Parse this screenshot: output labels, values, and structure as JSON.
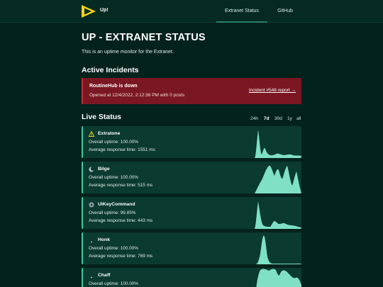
{
  "header": {
    "brand": "Up!",
    "nav": [
      {
        "label": "Extranet Status",
        "active": true
      },
      {
        "label": "GitHub",
        "active": false
      }
    ],
    "logo_icon": "play-triangle-icon"
  },
  "page": {
    "title": "UP - EXTRANET STATUS",
    "intro": "This is an uptime monitor for the Extranet."
  },
  "incidents": {
    "title": "Active Incidents",
    "items": [
      {
        "title": "RoutineHub is down",
        "opened": "Opened at 12/4/2022, 2:12:36 PM with 0 posts",
        "link": "Incident #548 report →"
      }
    ]
  },
  "live": {
    "title": "Live Status",
    "ranges": [
      "24h",
      "7d",
      "30d",
      "1y",
      "all"
    ],
    "active_range": "7d",
    "services": [
      {
        "name": "Extratone",
        "icon": "warning-triangle-icon",
        "uptime": "Overall uptime:  100.00%",
        "response": "Average response time:  1551 ms"
      },
      {
        "name": "Bilge",
        "icon": "moon-icon",
        "uptime": "Overall uptime:  100.00%",
        "response": "Average response time:  515 ms"
      },
      {
        "name": "UIKeyCommand",
        "icon": "play-circle-icon",
        "uptime": "Overall uptime:  99.85%",
        "response": "Average response time:  443 ms"
      },
      {
        "name": "Honk",
        "icon": "dot-icon",
        "uptime": "Overall uptime:  100.00%",
        "response": "Average response time:  769 ms"
      },
      {
        "name": "Chaff",
        "icon": "dot-icon",
        "uptime": "Overall uptime:  100.00%",
        "response": ""
      }
    ]
  },
  "colors": {
    "background": "#04221c",
    "incident": "#7a1722",
    "card": "#0b3a30",
    "accent": "#3fc99f",
    "sparkline": "#7fe0c6",
    "logo": "#f2d21b"
  }
}
